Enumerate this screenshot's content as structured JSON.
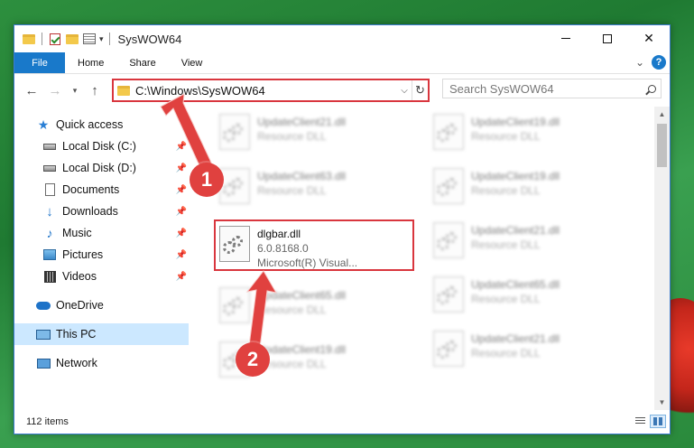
{
  "window": {
    "title": "SysWOW64"
  },
  "ribbon": {
    "tabs": [
      "File",
      "Home",
      "Share",
      "View"
    ]
  },
  "address": {
    "path": "C:\\Windows\\SysWOW64",
    "search_placeholder": "Search SysWOW64"
  },
  "nav": {
    "quick_access": "Quick access",
    "items": [
      {
        "label": "Local Disk (C:)",
        "icon": "disk-icon"
      },
      {
        "label": "Local Disk (D:)",
        "icon": "disk-icon"
      },
      {
        "label": "Documents",
        "icon": "documents-icon"
      },
      {
        "label": "Downloads",
        "icon": "downloads-icon"
      },
      {
        "label": "Music",
        "icon": "music-icon"
      },
      {
        "label": "Pictures",
        "icon": "pictures-icon"
      },
      {
        "label": "Videos",
        "icon": "videos-icon"
      }
    ],
    "onedrive": "OneDrive",
    "this_pc": "This PC",
    "network": "Network"
  },
  "files": {
    "left": [
      {
        "name": "UpdateClient21.dll",
        "meta": "Resource DLL"
      },
      {
        "name": "UpdateClient63.dll",
        "meta": "Resource DLL"
      },
      {
        "name": "dlgbar.dll",
        "version": "6.0.8168.0",
        "meta": "Microsoft(R) Visual..."
      },
      {
        "name": "UpdateClient65.dll",
        "meta": "Resource DLL"
      },
      {
        "name": "UpdateClient19.dll",
        "meta": "Resource DLL"
      }
    ],
    "right": [
      {
        "name": "UpdateClient19.dll",
        "meta": "Resource DLL"
      },
      {
        "name": "UpdateClient19.dll",
        "meta": "Resource DLL"
      },
      {
        "name": "UpdateClient21.dll",
        "meta": "Resource DLL"
      },
      {
        "name": "UpdateClient65.dll",
        "meta": "Resource DLL"
      },
      {
        "name": "UpdateClient21.dll",
        "meta": "Resource DLL"
      }
    ]
  },
  "status": {
    "count": "112 items"
  },
  "annotations": {
    "step1": "1",
    "step2": "2",
    "color": "#e0413f"
  }
}
